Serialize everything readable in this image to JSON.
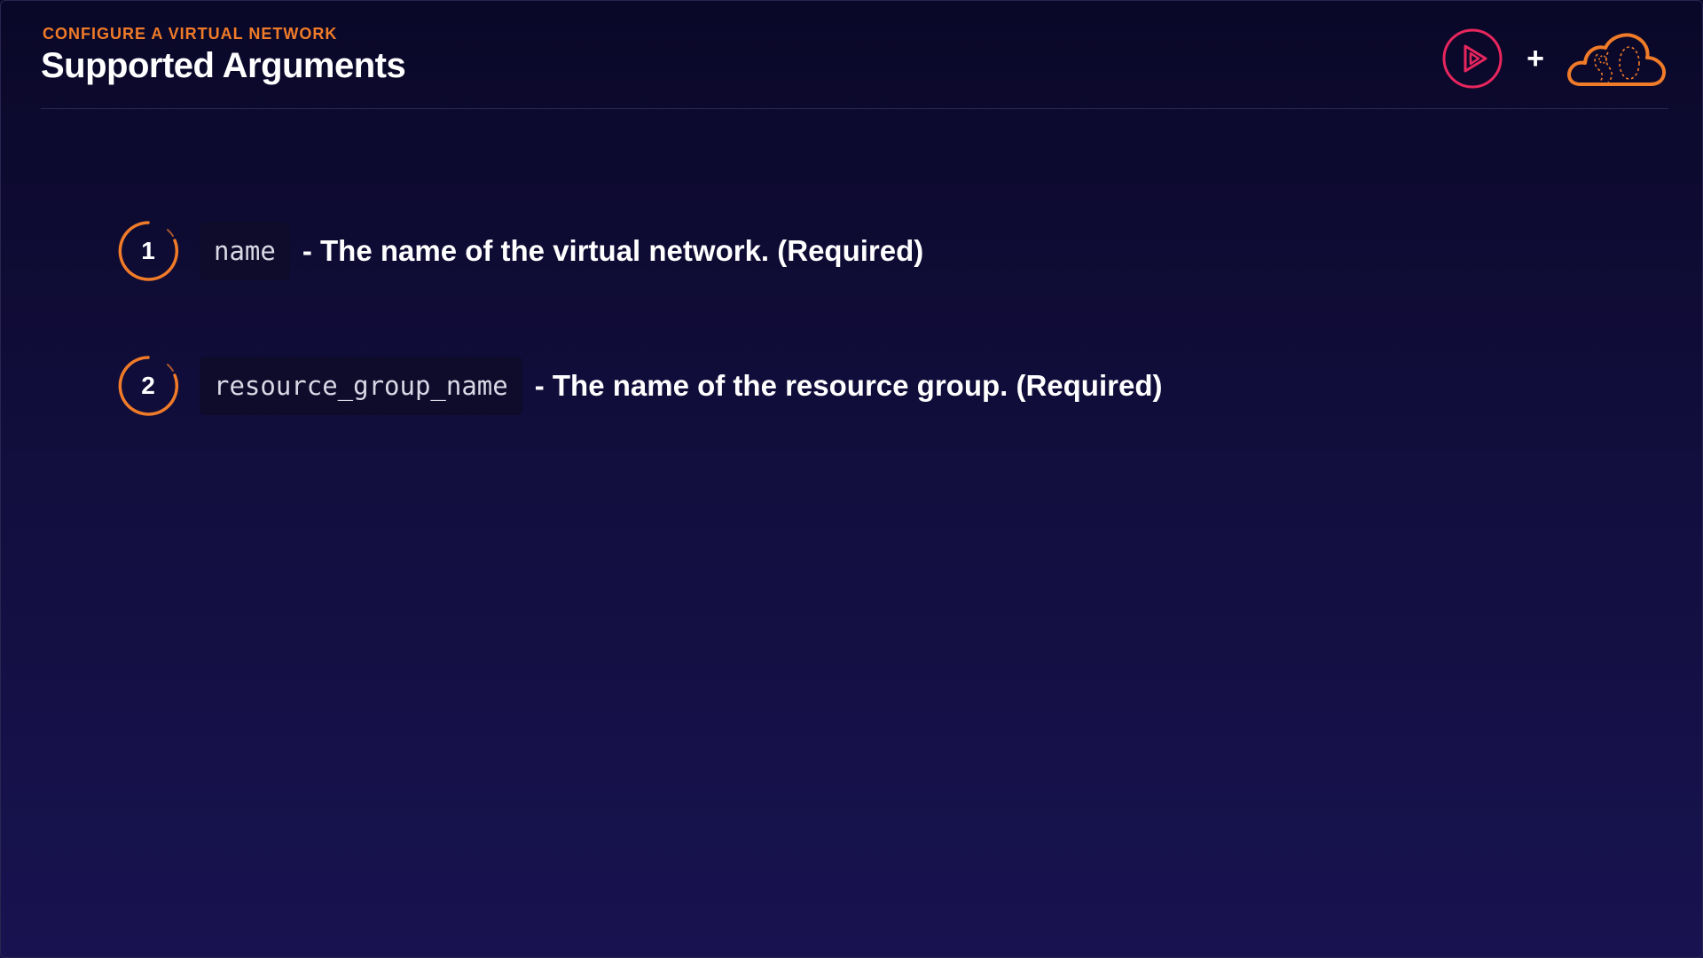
{
  "header": {
    "eyebrow": "CONFIGURE A VIRTUAL NETWORK",
    "title": "Supported Arguments",
    "logo_separator": "+",
    "logos": [
      "play-logo-icon",
      "cloud-logo-icon"
    ]
  },
  "arguments": [
    {
      "number": "1",
      "code": "name",
      "description": "- The name of the virtual network. (Required)"
    },
    {
      "number": "2",
      "code": "resource_group_name",
      "description": "- The name of the resource group. (Required)"
    }
  ],
  "colors": {
    "accent": "#f07b28",
    "play_logo": "#e8265e",
    "background_top": "#0a0828",
    "background_bottom": "#181350"
  }
}
